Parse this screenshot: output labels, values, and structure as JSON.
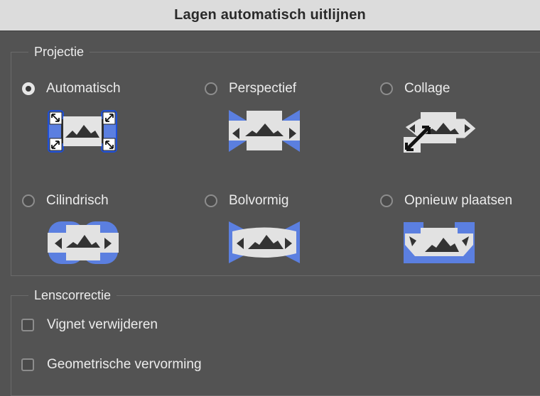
{
  "window": {
    "title": "Lagen automatisch uitlijnen"
  },
  "projection": {
    "legend": "Projectie",
    "selected": "Automatisch",
    "options": [
      {
        "label": "Automatisch",
        "checked": true,
        "icon": "auto-layout-icon"
      },
      {
        "label": "Perspectief",
        "checked": false,
        "icon": "perspective-layout-icon"
      },
      {
        "label": "Collage",
        "checked": false,
        "icon": "collage-layout-icon"
      },
      {
        "label": "Cilindrisch",
        "checked": false,
        "icon": "cylindrical-layout-icon"
      },
      {
        "label": "Bolvormig",
        "checked": false,
        "icon": "spherical-layout-icon"
      },
      {
        "label": "Opnieuw plaatsen",
        "checked": false,
        "icon": "reposition-layout-icon"
      }
    ]
  },
  "lens": {
    "legend": "Lenscorrectie",
    "options": [
      {
        "label": "Vignet verwijderen",
        "checked": false
      },
      {
        "label": "Geometrische vervorming",
        "checked": false
      }
    ]
  },
  "colors": {
    "accent": "#5b7fe0",
    "panel": "#535353",
    "titlebar": "#dcdcdc",
    "thumb_fill": "#e2e2e2"
  }
}
